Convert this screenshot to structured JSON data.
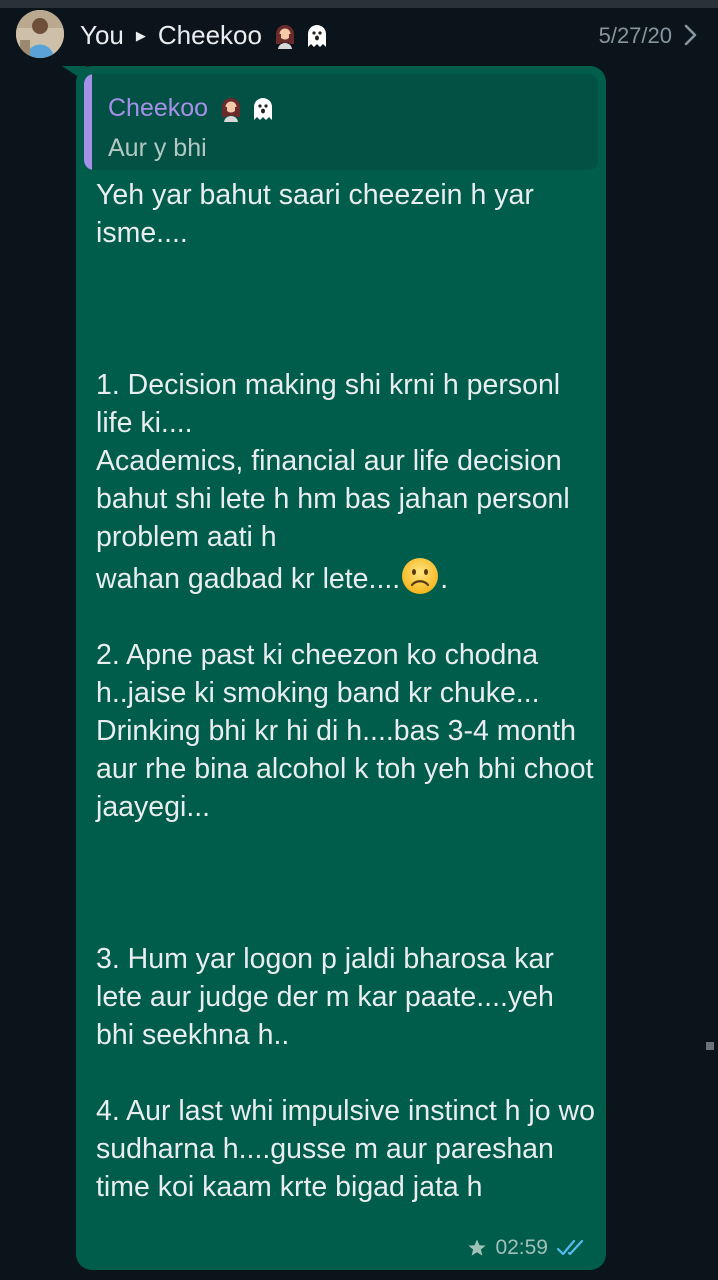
{
  "header": {
    "sender": "You",
    "recipient": "Cheekoo",
    "recipient_emojis": [
      "woman-emoji",
      "ghost-emoji"
    ],
    "date": "5/27/20"
  },
  "quote": {
    "name": "Cheekoo",
    "text": "Aur y bhi"
  },
  "message": {
    "text_part1": "Yeh yar bahut saari cheezein h yar isme....\n\n\n\n1. Decision making shi krni h personl life ki....\nAcademics, financial aur life decision bahut shi lete h hm bas jahan personl problem aati h\nwahan gadbad kr lete....",
    "emoji": "frowning-face-emoji",
    "text_part2": ".\n\n2. Apne past ki cheezon ko chodna h..jaise ki smoking band kr chuke...\nDrinking bhi kr hi di h....bas 3-4 month aur rhe bina alcohol k toh yeh bhi choot jaayegi...\n\n\n\n3. Hum yar logon p jaldi bharosa kar lete aur judge der m kar paate....yeh bhi seekhna h..\n\n4. Aur last whi impulsive instinct h jo wo sudharna h....gusse m aur pareshan time koi kaam krte bigad jata h",
    "time": "02:59",
    "starred": true,
    "status": "read"
  },
  "colors": {
    "background": "#0b141a",
    "bubble": "#005c4b",
    "quote_accent": "#a691e8",
    "read_ticks": "#53bdeb"
  }
}
